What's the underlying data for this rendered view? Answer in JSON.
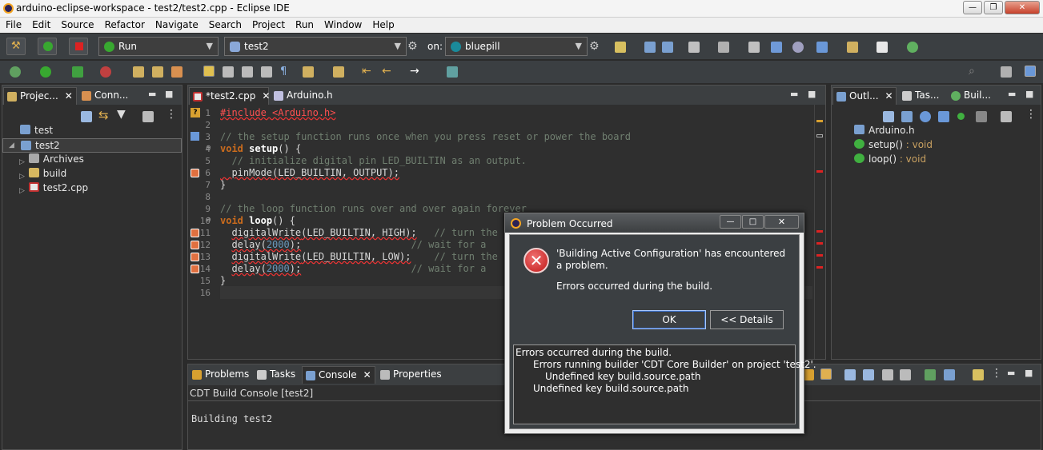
{
  "window": {
    "title": "arduino-eclipse-workspace - test2/test2.cpp - Eclipse IDE"
  },
  "menu": [
    "File",
    "Edit",
    "Source",
    "Refactor",
    "Navigate",
    "Search",
    "Project",
    "Run",
    "Window",
    "Help"
  ],
  "toolbar": {
    "launch_mode": "Run",
    "launch_config": "test2",
    "on_label": "on:",
    "target": "bluepill"
  },
  "project_explorer": {
    "tabs": [
      "Projec...",
      "Conn..."
    ],
    "items": [
      {
        "label": "test",
        "icon": "folder-icon"
      },
      {
        "label": "test2",
        "icon": "project-icon"
      },
      {
        "label": "Archives",
        "icon": "archives-icon"
      },
      {
        "label": "build",
        "icon": "folder-icon"
      },
      {
        "label": "test2.cpp",
        "icon": "cpp-file-icon"
      }
    ]
  },
  "editor": {
    "tabs": [
      "*test2.cpp",
      "Arduino.h"
    ],
    "line_numbers": [
      "1",
      "2",
      "3",
      "4",
      "5",
      "6",
      "7",
      "8",
      "9",
      "10",
      "11",
      "12",
      "13",
      "14",
      "15",
      "16"
    ],
    "lines": {
      "l1": "#include <Arduino.h>",
      "l3": "// the setup function runs once when you press reset or power the board",
      "l4_kw": "void",
      "l4_fn": "setup",
      "l4_rest": "() {",
      "l5": "  // initialize digital pin LED_BUILTIN as an output.",
      "l6_fn": "pinMode",
      "l6_rest": "(LED_BUILTIN, OUTPUT);",
      "l7": "}",
      "l9": "// the loop function runs over and over again forever",
      "l10_kw": "void",
      "l10_fn": "loop",
      "l10_rest": "() {",
      "l11_fn": "digitalWrite",
      "l11_arg": "(LED_BUILTIN, HIGH);",
      "l11_cmt": "// turn the LE",
      "l12_fn": "delay",
      "l12_open": "(",
      "l12_num": "2000",
      "l12_close": ");",
      "l12_cmt": "// wait for a",
      "l13_fn": "digitalWrite",
      "l13_arg": "(LED_BUILTIN, LOW);",
      "l13_cmt": "// turn the LE",
      "l14_fn": "delay",
      "l14_open": "(",
      "l14_num": "2000",
      "l14_close": ");",
      "l14_cmt": "// wait for a",
      "l15": "}"
    }
  },
  "outline": {
    "tabs": [
      "Outl...",
      "Tas...",
      "Buil..."
    ],
    "items": [
      {
        "name": "Arduino.h",
        "type": ""
      },
      {
        "name": "setup()",
        "type": " : void"
      },
      {
        "name": "loop()",
        "type": " : void"
      }
    ]
  },
  "bottom": {
    "tabs": [
      "Problems",
      "Tasks",
      "Console",
      "Properties"
    ],
    "console_title": "CDT Build Console [test2]",
    "console_text": "Building test2"
  },
  "dialog": {
    "title": "Problem Occurred",
    "message": "'Building Active Configuration' has encountered a problem.",
    "sub_message": "Errors occurred during the build.",
    "ok_label": "OK",
    "details_label": "<< Details",
    "details": [
      "Errors occurred during the build.",
      "Errors running builder 'CDT Core Builder' on project 'test2'.",
      "Undefined key build.source.path",
      "Undefined key build.source.path"
    ]
  },
  "colors": {
    "error": "#dd2222",
    "dialog_bg": "#3b3f42",
    "ide_bg": "#2f2f2f"
  }
}
